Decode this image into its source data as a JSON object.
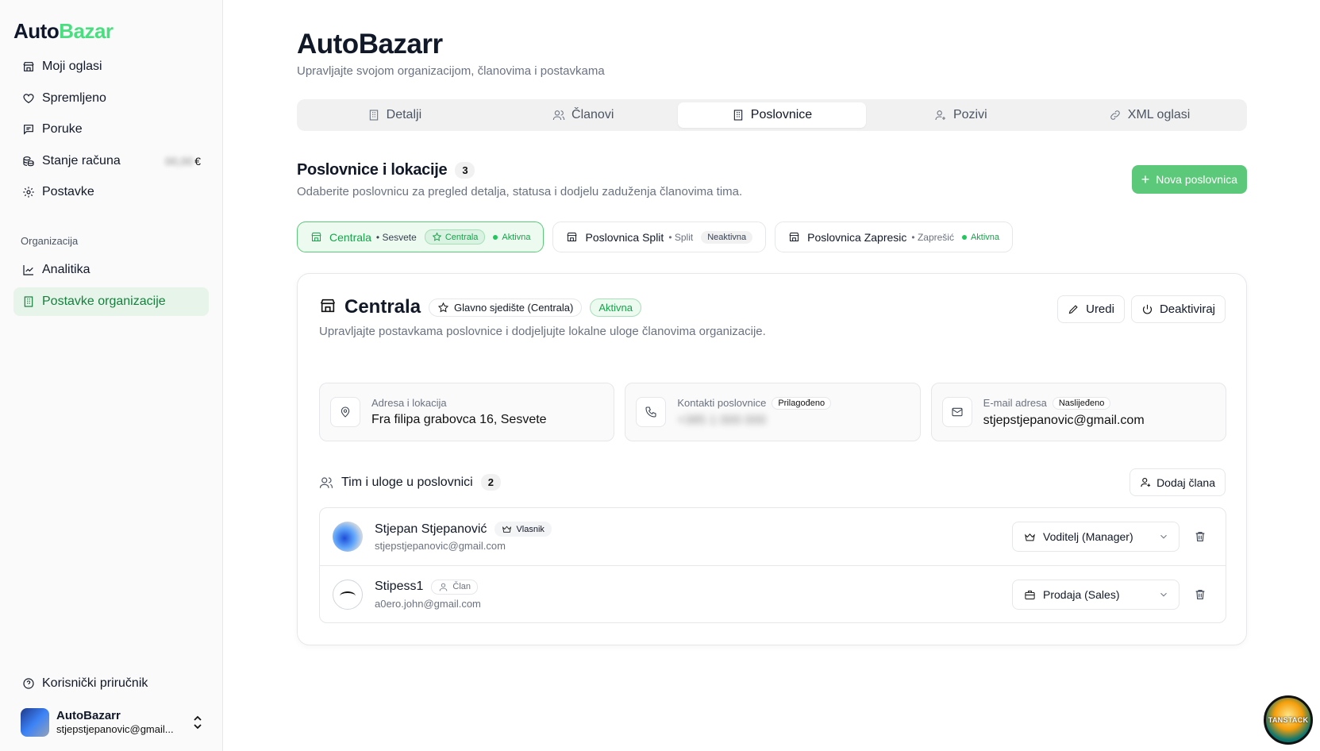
{
  "app": {
    "logo_part1": "Auto",
    "logo_part2": "Bazar"
  },
  "sidebar": {
    "items": [
      {
        "label": "Moji oglasi",
        "icon": "store-icon"
      },
      {
        "label": "Spremljeno",
        "icon": "heart-icon"
      },
      {
        "label": "Poruke",
        "icon": "message-icon"
      },
      {
        "label": "Stanje računa",
        "icon": "coins-icon",
        "balance": "00,00",
        "currency": "€"
      },
      {
        "label": "Postavke",
        "icon": "gear-icon"
      }
    ],
    "section_label": "Organizacija",
    "org_items": [
      {
        "label": "Analitika",
        "icon": "chart-icon"
      },
      {
        "label": "Postavke organizacije",
        "icon": "building-icon",
        "active": true
      }
    ],
    "help_label": "Korisnički priručnik",
    "user": {
      "name": "AutoBazarr",
      "email": "stjepstjepanovic@gmail..."
    }
  },
  "header": {
    "title": "AutoBazarr",
    "subtitle": "Upravljajte svojom organizacijom, članovima i postavkama"
  },
  "tabs": [
    {
      "label": "Detalji",
      "icon": "building-icon"
    },
    {
      "label": "Članovi",
      "icon": "users-icon"
    },
    {
      "label": "Poslovnice",
      "icon": "building-icon",
      "active": true
    },
    {
      "label": "Pozivi",
      "icon": "user-plus-icon"
    },
    {
      "label": "XML oglasi",
      "icon": "link-icon"
    }
  ],
  "branches_section": {
    "title": "Poslovnice i lokacije",
    "count": "3",
    "subtitle": "Odaberite poslovnicu za pregled detalja, statusa i dodjelu zaduženja članovima tima.",
    "new_button": "Nova poslovnica",
    "branches": [
      {
        "name": "Centrala",
        "location": "• Sesvete",
        "badge": "Centrala",
        "status": "Aktivna"
      },
      {
        "name": "Poslovnica Split",
        "location": "• Split",
        "status_badge": "Neaktivna"
      },
      {
        "name": "Poslovnica Zapresic",
        "location": "• Zaprešić",
        "status": "Aktivna"
      }
    ]
  },
  "detail": {
    "title": "Centrala",
    "hq_badge": "Glavno sjedište (Centrala)",
    "status": "Aktivna",
    "subtitle": "Upravljajte postavkama poslovnice i dodjeljujte lokalne uloge članovima organizacije.",
    "edit_button": "Uredi",
    "deactivate_button": "Deaktiviraj",
    "address": {
      "label": "Adresa i lokacija",
      "value": "Fra filipa grabovca 16, Sesvete"
    },
    "contacts": {
      "label": "Kontakti poslovnice",
      "tag": "Prilagođeno",
      "value": "+385 1 000 000"
    },
    "email": {
      "label": "E-mail adresa",
      "tag": "Naslijeđeno",
      "value": "stjepstjepanovic@gmail.com"
    },
    "team": {
      "title": "Tim i uloge u poslovnici",
      "count": "2",
      "add_button": "Dodaj člana",
      "members": [
        {
          "name": "Stjepan Stjepanović",
          "tag": "Vlasnik",
          "email": "stjepstjepanovic@gmail.com",
          "role": "Voditelj (Manager)"
        },
        {
          "name": "Stipess1",
          "tag": "Član",
          "email": "a0ero.john@gmail.com",
          "role": "Prodaja (Sales)"
        }
      ]
    }
  },
  "badge_text": "TANSTACK"
}
